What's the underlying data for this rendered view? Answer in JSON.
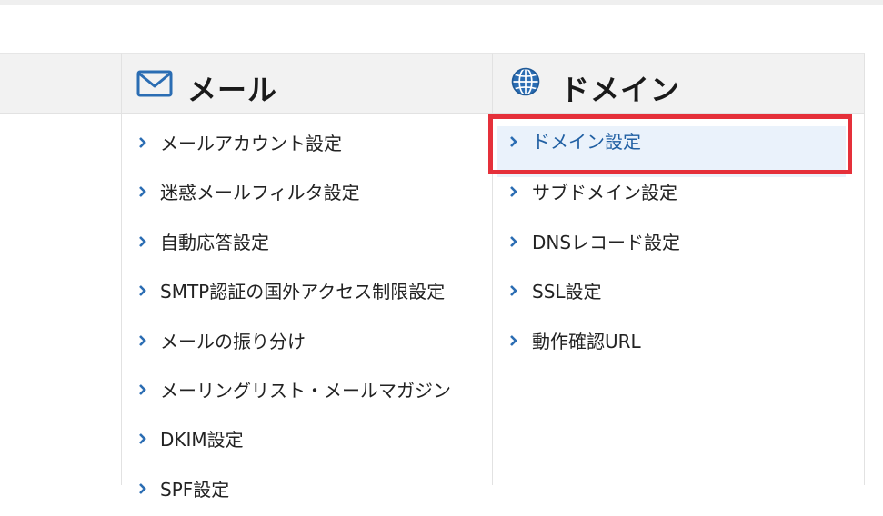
{
  "mail_section": {
    "title": "メール",
    "items": [
      {
        "label": "メールアカウント設定"
      },
      {
        "label": "迷惑メールフィルタ設定"
      },
      {
        "label": "自動応答設定"
      },
      {
        "label": "SMTP認証の国外アクセス制限設定"
      },
      {
        "label": "メールの振り分け"
      },
      {
        "label": "メーリングリスト・メールマガジン"
      },
      {
        "label": "DKIM設定"
      },
      {
        "label": "SPF設定"
      }
    ]
  },
  "domain_section": {
    "title": "ドメイン",
    "items": [
      {
        "label": "ドメイン設定",
        "selected": true
      },
      {
        "label": "サブドメイン設定"
      },
      {
        "label": "DNSレコード設定"
      },
      {
        "label": "SSL設定"
      },
      {
        "label": "動作確認URL"
      }
    ]
  },
  "colors": {
    "accent": "#2160a3",
    "highlight_border": "#e5303a",
    "selected_bg": "#eaf2fb",
    "header_bg": "#f2f2f2"
  },
  "icons": {
    "mail": "envelope-icon",
    "domain": "globe-icon",
    "chevron": "chevron-right-icon"
  }
}
